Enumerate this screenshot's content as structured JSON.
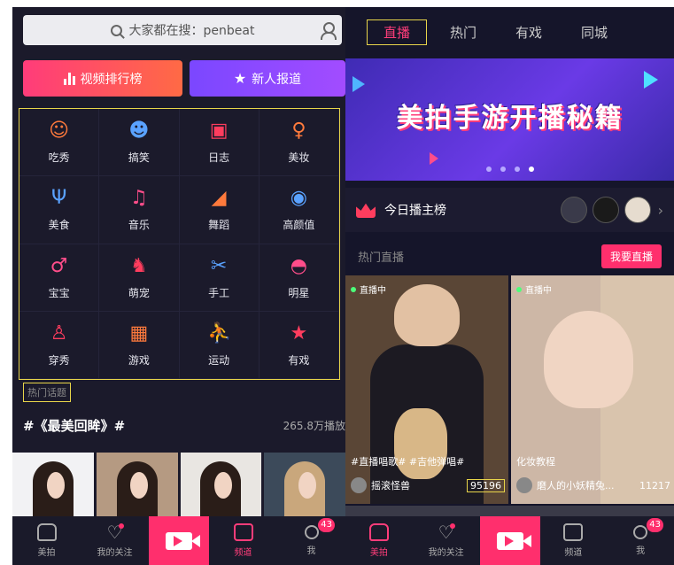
{
  "left": {
    "search": {
      "placeholder": "大家都在搜：penbeat"
    },
    "buttons": {
      "rank": "视频排行榜",
      "new": "新人报道"
    },
    "categories": [
      {
        "label": "吃秀",
        "icon": "eating-face-icon",
        "color": "#ff7a3c"
      },
      {
        "label": "搞笑",
        "icon": "laughing-face-icon",
        "color": "#5aa2ff"
      },
      {
        "label": "日志",
        "icon": "diary-book-icon",
        "color": "#ff3d5e"
      },
      {
        "label": "美妆",
        "icon": "makeup-icon",
        "color": "#ff7a3c"
      },
      {
        "label": "美食",
        "icon": "fork-knife-icon",
        "color": "#5aa2ff"
      },
      {
        "label": "音乐",
        "icon": "music-note-icon",
        "color": "#ff4d8a"
      },
      {
        "label": "舞蹈",
        "icon": "dance-icon",
        "color": "#ff7a3c"
      },
      {
        "label": "高颜值",
        "icon": "face-mask-icon",
        "color": "#5aa2ff"
      },
      {
        "label": "宝宝",
        "icon": "baby-pacifier-icon",
        "color": "#ff4d8a"
      },
      {
        "label": "萌宠",
        "icon": "pet-dog-icon",
        "color": "#ff3d5e"
      },
      {
        "label": "手工",
        "icon": "scissors-icon",
        "color": "#5aa2ff"
      },
      {
        "label": "明星",
        "icon": "sunglasses-icon",
        "color": "#ff4d8a"
      },
      {
        "label": "穿秀",
        "icon": "dress-icon",
        "color": "#ff3d5e"
      },
      {
        "label": "游戏",
        "icon": "gamepad-icon",
        "color": "#ff7a3c"
      },
      {
        "label": "运动",
        "icon": "sport-icon",
        "color": "#ff4d8a"
      },
      {
        "label": "有戏",
        "icon": "star-icon",
        "color": "#ff3d5e"
      }
    ],
    "hot_topic_label": "热门话题",
    "topic": {
      "title": "#《最美回眸》#",
      "count": "265.8万播放"
    },
    "nav": {
      "home": "美拍",
      "follow": "我的关注",
      "channel": "频道",
      "me": "我",
      "me_badge": "43"
    }
  },
  "right": {
    "tabs": [
      "直播",
      "热门",
      "有戏",
      "同城"
    ],
    "banner_text": "美拍手游开播秘籍",
    "rank_label": "今日播主榜",
    "hot_live_label": "热门直播",
    "go_live": "我要直播",
    "cards": [
      {
        "status": "直播中",
        "tags": "#直播唱歌# #吉他弹唱#",
        "name": "摇滚怪兽",
        "viewers": "95196"
      },
      {
        "status": "直播中",
        "tags": "化妆教程",
        "name": "磨人的小妖精兔...",
        "viewers": "11217"
      }
    ],
    "nav": {
      "home": "美拍",
      "follow": "我的关注",
      "channel": "频道",
      "me": "我",
      "me_badge": "43"
    }
  },
  "colors": {
    "accent": "#ff2f6d",
    "highlight": "#e8d54a",
    "background": "#1b1a2b"
  }
}
